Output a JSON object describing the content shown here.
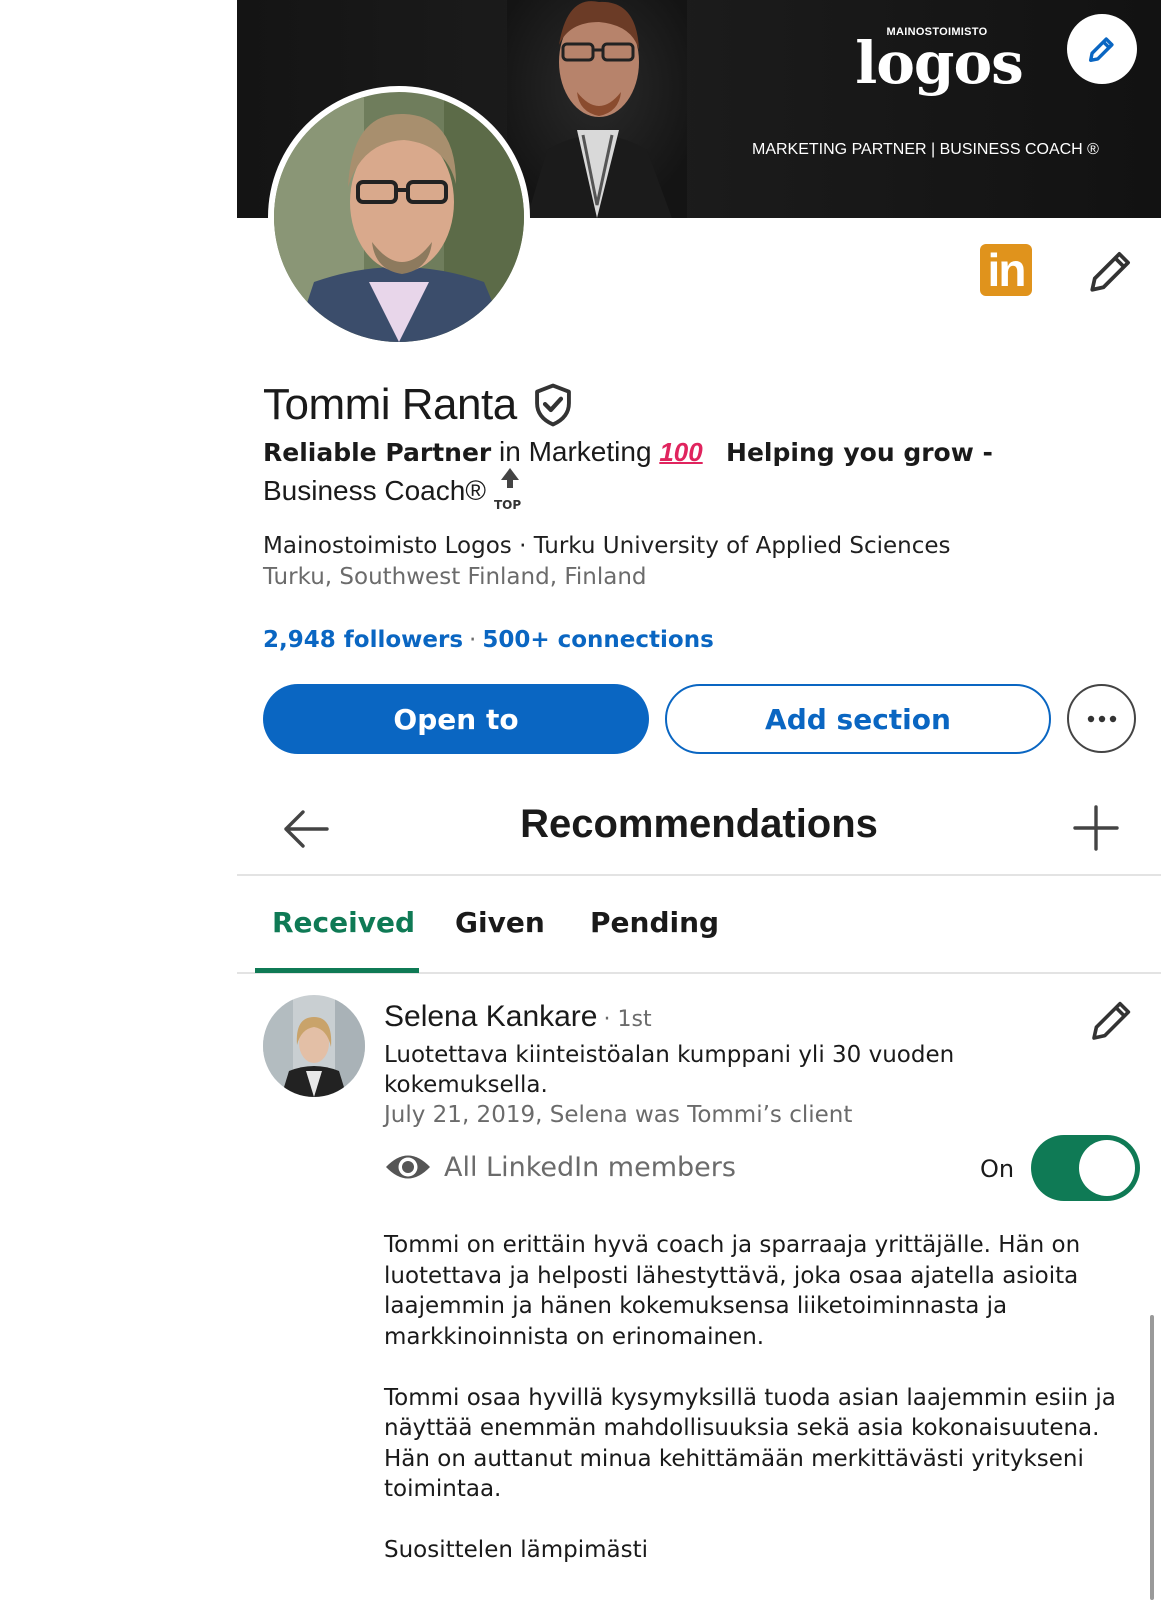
{
  "banner": {
    "logo_top": "MAINOSTOIMISTO",
    "logo_word": "logos",
    "tagline": "MARKETING PARTNER  |  BUSINESS COACH ®"
  },
  "profile": {
    "name": "Tommi Ranta",
    "headline_part1_bold": "Reliable Partner",
    "headline_part1": " in Marketing",
    "headline_emoji": "100",
    "headline_part2_bold": "Helping you grow -",
    "headline_part3": "Business Coach®",
    "top_label": "TOP",
    "company": "Mainostoimisto Logos · Turku University of Applied Sciences",
    "location": "Turku, Southwest Finland, Finland",
    "followers": "2,948 followers",
    "separator": "·",
    "connections": "500+ connections",
    "li_badge": "in"
  },
  "actions": {
    "open_to": "Open to",
    "add_section": "Add section"
  },
  "recommendations": {
    "title": "Recommendations",
    "tabs": [
      "Received",
      "Given",
      "Pending"
    ],
    "active_tab": 0,
    "item": {
      "name": "Selena Kankare",
      "degree": "· 1st",
      "headline": "Luotettava kiinteistöalan kumppani yli 30 vuoden kokemuksella.",
      "date_relation": "July 21, 2019, Selena was Tommi’s client",
      "visibility": "All LinkedIn members",
      "toggle_label": "On",
      "toggle_on": true,
      "body": [
        "Tommi on erittäin hyvä coach ja sparraaja yrittäjälle. Hän on luotettava ja helposti lähestyttävä, joka osaa ajatella asioita laajemmin ja hänen kokemuksensa liiketoiminnasta ja markkinoinnista on erinomainen.",
        "Tommi osaa hyvillä kysymyksillä tuoda asian laajemmin esiin ja näyttää enemmän mahdollisuuksia sekä asia kokonaisuutena. Hän on auttanut minua kehittämään merkittävästi yritykseni toimintaa.",
        "Suosittelen lämpimästi"
      ]
    }
  },
  "colors": {
    "linkedin_blue": "#0a66c2",
    "tab_green": "#0f7a55",
    "li_badge_orange": "#e0931c"
  }
}
